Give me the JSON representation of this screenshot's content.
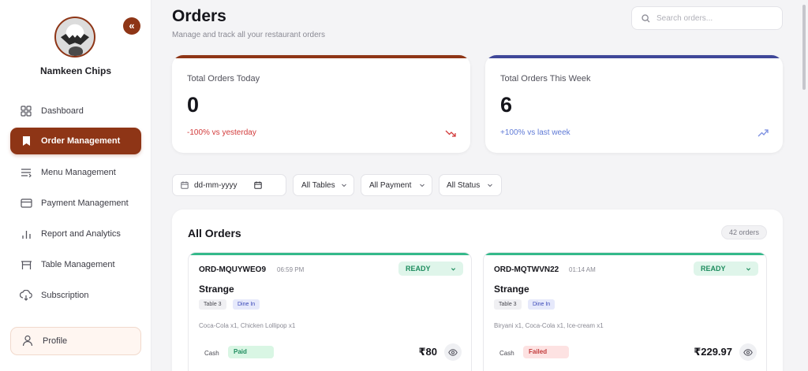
{
  "sidebar": {
    "brand_name": "Namkeen Chips",
    "collapse_label": "«",
    "items": [
      {
        "label": "Dashboard",
        "icon": "grid-icon"
      },
      {
        "label": "Order Management",
        "icon": "bookmark-icon",
        "active": true
      },
      {
        "label": "Menu Management",
        "icon": "list-icon"
      },
      {
        "label": "Payment Management",
        "icon": "credit-card-icon"
      },
      {
        "label": "Report and Analytics",
        "icon": "bar-chart-icon"
      },
      {
        "label": "Table Management",
        "icon": "table-icon"
      },
      {
        "label": "Subscription",
        "icon": "subscription-icon"
      }
    ],
    "profile_label": "Profile"
  },
  "header": {
    "title": "Orders",
    "subtitle": "Manage and track all your restaurant orders",
    "search_placeholder": "Search orders..."
  },
  "stats": [
    {
      "label": "Total Orders Today",
      "value": "0",
      "delta": "-100% vs yesterday",
      "trend": "down",
      "accent": "#8e3516",
      "delta_color": "#d23b3b"
    },
    {
      "label": "Total Orders This Week",
      "value": "6",
      "delta": "+100% vs last week",
      "trend": "up",
      "accent": "#3f4799",
      "delta_color": "#5f7ad6"
    }
  ],
  "filters": {
    "date_placeholder": "dd-mm-yyyy",
    "tables": "All Tables",
    "payment": "All Payment",
    "status": "All Status"
  },
  "orders": {
    "title": "All Orders",
    "count": "42 orders",
    "list": [
      {
        "id": "ORD-MQUYWEO9",
        "time": "06:59 PM",
        "status": "READY",
        "customer": "Strange",
        "table": "Table 3",
        "type": "Dine In",
        "items": "Coca-Cola x1, Chicken Lollipop x1",
        "payment_method": "Cash",
        "payment_status": "Paid",
        "amount": "₹80"
      },
      {
        "id": "ORD-MQTWVN22",
        "time": "01:14 AM",
        "status": "READY",
        "customer": "Strange",
        "table": "Table 3",
        "type": "Dine In",
        "items": "Biryani x1, Coca-Cola x1, Ice-cream x1",
        "payment_method": "Cash",
        "payment_status": "Failed",
        "amount": "₹229.97"
      }
    ]
  },
  "colors": {
    "brand": "#8e3516",
    "ready_green": "#34b98a",
    "week_accent": "#3f4799"
  }
}
